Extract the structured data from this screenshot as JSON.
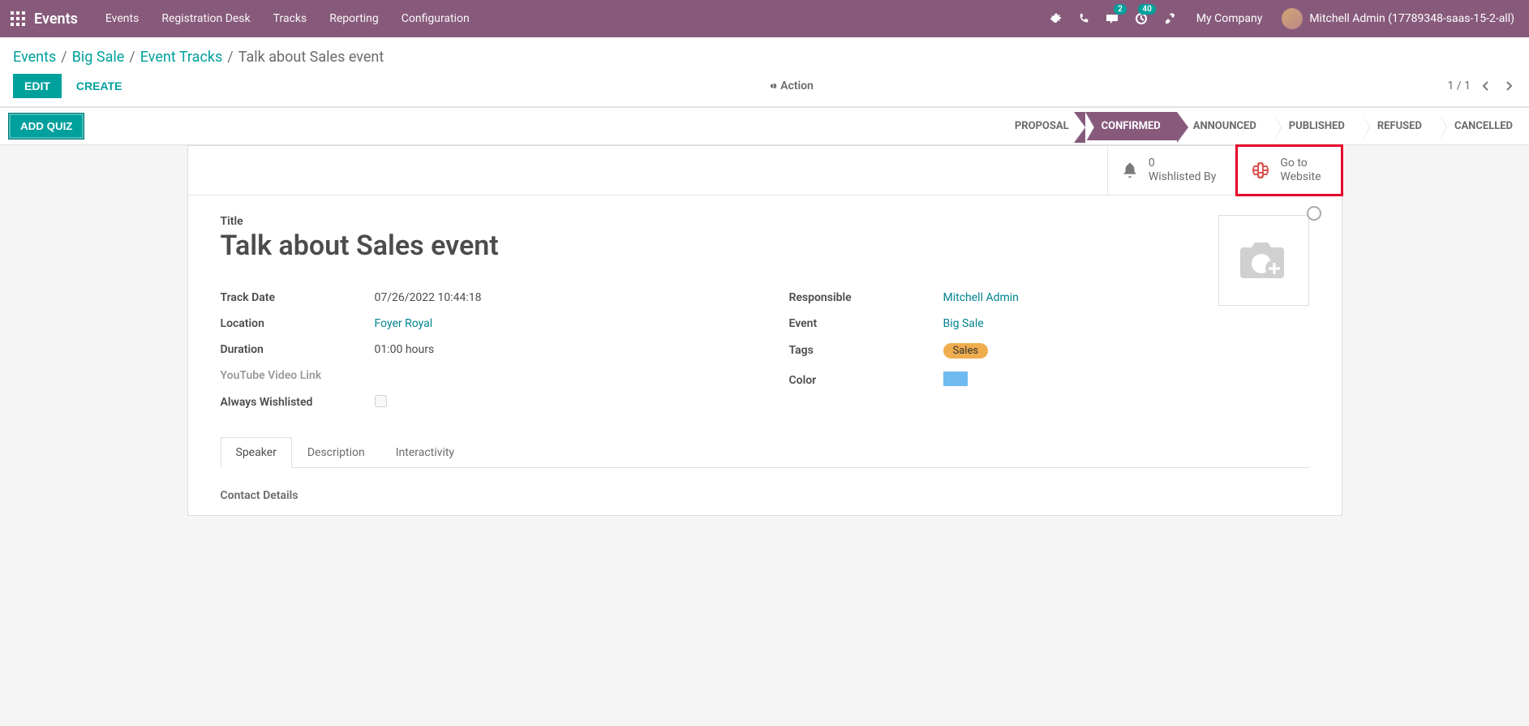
{
  "topbar": {
    "app_name": "Events",
    "nav": [
      "Events",
      "Registration Desk",
      "Tracks",
      "Reporting",
      "Configuration"
    ],
    "messages_badge": "2",
    "activities_badge": "40",
    "company": "My Company",
    "user": "Mitchell Admin (17789348-saas-15-2-all)"
  },
  "breadcrumb": {
    "root": "Events",
    "l1": "Big Sale",
    "l2": "Event Tracks",
    "current": "Talk about Sales event"
  },
  "controls": {
    "edit": "EDIT",
    "create": "CREATE",
    "action": "Action",
    "pager": "1 / 1"
  },
  "statusrow": {
    "add_quiz": "ADD QUIZ",
    "steps": [
      "PROPOSAL",
      "CONFIRMED",
      "ANNOUNCED",
      "PUBLISHED",
      "REFUSED",
      "CANCELLED"
    ],
    "active_index": 1
  },
  "statbuttons": {
    "wishlisted_count": "0",
    "wishlisted_label": "Wishlisted By",
    "goto_l1": "Go to",
    "goto_l2": "Website"
  },
  "form": {
    "title_label": "Title",
    "title_value": "Talk about Sales event",
    "fields_left": {
      "track_date_label": "Track Date",
      "track_date_value": "07/26/2022 10:44:18",
      "location_label": "Location",
      "location_value": "Foyer Royal",
      "duration_label": "Duration",
      "duration_value": "01:00 hours",
      "youtube_label": "YouTube Video Link",
      "always_wish_label": "Always Wishlisted"
    },
    "fields_right": {
      "responsible_label": "Responsible",
      "responsible_value": "Mitchell Admin",
      "event_label": "Event",
      "event_value": "Big Sale",
      "tags_label": "Tags",
      "tags_value": "Sales",
      "color_label": "Color"
    },
    "tabs": [
      "Speaker",
      "Description",
      "Interactivity"
    ],
    "active_tab": 0,
    "tab_section": "Contact Details"
  }
}
